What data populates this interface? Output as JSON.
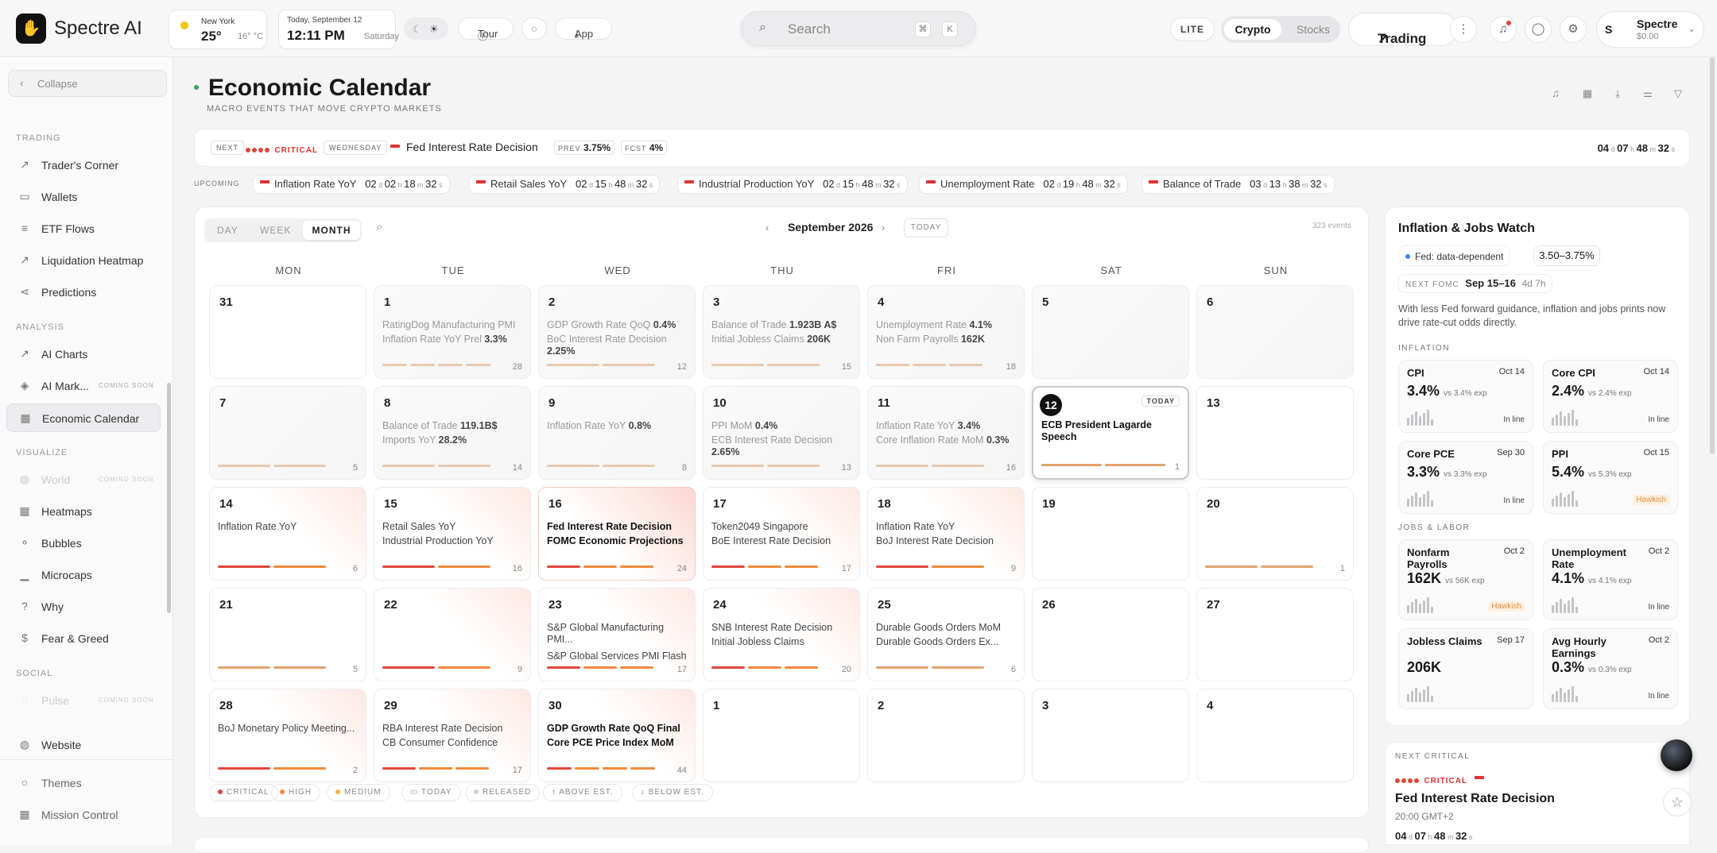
{
  "app": {
    "brand": "Spectre AI",
    "logo_icon": "hand-icon"
  },
  "weather": {
    "city": "New York",
    "temp": "25°",
    "range": "16° °C"
  },
  "datetime": {
    "date": "Today, September 12",
    "time": "12:11 PM",
    "weekday": "Saturday"
  },
  "topbar": {
    "tour": "Tour",
    "app": "App",
    "search_placeholder": "Search",
    "kbd1": "⌘",
    "kbd2": "K",
    "lite": "LITE",
    "crypto": "Crypto",
    "stocks": "Stocks",
    "trading": "Trading",
    "account_initial": "S",
    "account_name": "Spectre",
    "account_balance": "$0.00"
  },
  "sidebar": {
    "collapse": "Collapse",
    "sections": {
      "trading": "TRADING",
      "analysis": "ANALYSIS",
      "visualize": "VISUALIZE",
      "social": "SOCIAL"
    },
    "trading": [
      "Trader's Corner",
      "Wallets",
      "ETF Flows",
      "Liquidation Heatmap",
      "Predictions"
    ],
    "analysis": [
      "AI Charts",
      "AI Mark...",
      "Economic Calendar"
    ],
    "ai_markets_badge": "COMING SOON",
    "visualize": [
      "World",
      "Heatmaps",
      "Bubbles",
      "Microcaps",
      "Why",
      "Fear & Greed"
    ],
    "world_badge": "COMING SOON",
    "social": [
      "Pulse"
    ],
    "pulse_badge": "COMING SOON",
    "footer": [
      "Website",
      "Themes",
      "Mission Control"
    ]
  },
  "page": {
    "title": "Economic Calendar",
    "subtitle": "MACRO EVENTS THAT MOVE CRYPTO MARKETS"
  },
  "next_event": {
    "label": "NEXT",
    "impact": "CRITICAL",
    "day": "WEDNESDAY",
    "name": "Fed Interest Rate Decision",
    "prev_label": "PREV",
    "prev": "3.75%",
    "fcst_label": "FCST",
    "fcst": "4%",
    "countdown": {
      "d": "04",
      "h": "07",
      "m": "48",
      "s": "32"
    }
  },
  "upcoming": {
    "label": "UPCOMING",
    "items": [
      {
        "name": "Inflation Rate YoY",
        "d": "02",
        "h": "02",
        "m": "18",
        "s": "32"
      },
      {
        "name": "Retail Sales YoY",
        "d": "02",
        "h": "15",
        "m": "48",
        "s": "32"
      },
      {
        "name": "Industrial Production YoY",
        "d": "02",
        "h": "15",
        "m": "48",
        "s": "32"
      },
      {
        "name": "Unemployment Rate",
        "d": "02",
        "h": "19",
        "m": "48",
        "s": "32"
      },
      {
        "name": "Balance of Trade",
        "d": "03",
        "h": "13",
        "m": "38",
        "s": "32"
      }
    ]
  },
  "calendar": {
    "views": [
      "DAY",
      "WEEK",
      "MONTH"
    ],
    "month": "September 2026",
    "today_btn": "TODAY",
    "event_count": "323 events",
    "weekdays": [
      "MON",
      "TUE",
      "WED",
      "THU",
      "FRI",
      "SAT",
      "SUN"
    ],
    "today_badge": "TODAY",
    "cells": [
      {
        "day": "31",
        "events": [],
        "count": ""
      },
      {
        "day": "1",
        "events": [
          {
            "t": "RatingDog Manufacturing PMI",
            "v": ""
          },
          {
            "t": "Inflation Rate YoY Prel",
            "v": "3.3%"
          }
        ],
        "count": "28"
      },
      {
        "day": "2",
        "events": [
          {
            "t": "GDP Growth Rate QoQ",
            "v": "0.4%"
          },
          {
            "t": "BoC Interest Rate Decision",
            "v": "2.25%"
          }
        ],
        "count": "12"
      },
      {
        "day": "3",
        "events": [
          {
            "t": "Balance of Trade",
            "v": "1.923B A$"
          },
          {
            "t": "Initial Jobless Claims",
            "v": "206K"
          }
        ],
        "count": "15"
      },
      {
        "day": "4",
        "events": [
          {
            "t": "Unemployment Rate",
            "v": "4.1%"
          },
          {
            "t": "Non Farm Payrolls",
            "v": "162K"
          }
        ],
        "count": "18"
      },
      {
        "day": "5",
        "events": [],
        "count": ""
      },
      {
        "day": "6",
        "events": [],
        "count": ""
      },
      {
        "day": "7",
        "events": [],
        "count": "5"
      },
      {
        "day": "8",
        "events": [
          {
            "t": "Balance of Trade",
            "v": "119.1B$"
          },
          {
            "t": "Imports YoY",
            "v": "28.2%"
          }
        ],
        "count": "14"
      },
      {
        "day": "9",
        "events": [
          {
            "t": "Inflation Rate YoY",
            "v": "0.8%"
          }
        ],
        "count": "8"
      },
      {
        "day": "10",
        "events": [
          {
            "t": "PPI MoM",
            "v": "0.4%"
          },
          {
            "t": "ECB Interest Rate Decision",
            "v": "2.65%"
          }
        ],
        "count": "13"
      },
      {
        "day": "11",
        "events": [
          {
            "t": "Inflation Rate YoY",
            "v": "3.4%"
          },
          {
            "t": "Core Inflation Rate MoM",
            "v": "0.3%"
          }
        ],
        "count": "16"
      },
      {
        "day": "12",
        "events": [
          {
            "t": "ECB President Lagarde Speech",
            "v": ""
          }
        ],
        "count": "1"
      },
      {
        "day": "13",
        "events": [],
        "count": ""
      },
      {
        "day": "14",
        "events": [
          {
            "t": "Inflation Rate YoY",
            "v": ""
          }
        ],
        "count": "6"
      },
      {
        "day": "15",
        "events": [
          {
            "t": "Retail Sales YoY",
            "v": ""
          },
          {
            "t": "Industrial Production YoY",
            "v": ""
          }
        ],
        "count": "16"
      },
      {
        "day": "16",
        "events": [
          {
            "t": "Fed Interest Rate Decision",
            "v": ""
          },
          {
            "t": "FOMC Economic Projections",
            "v": ""
          }
        ],
        "count": "24"
      },
      {
        "day": "17",
        "events": [
          {
            "t": "Token2049 Singapore",
            "v": ""
          },
          {
            "t": "BoE Interest Rate Decision",
            "v": ""
          }
        ],
        "count": "17"
      },
      {
        "day": "18",
        "events": [
          {
            "t": "Inflation Rate YoY",
            "v": ""
          },
          {
            "t": "BoJ Interest Rate Decision",
            "v": ""
          }
        ],
        "count": "9"
      },
      {
        "day": "19",
        "events": [],
        "count": ""
      },
      {
        "day": "20",
        "events": [],
        "count": "1"
      },
      {
        "day": "21",
        "events": [],
        "count": "5"
      },
      {
        "day": "22",
        "events": [],
        "count": "9"
      },
      {
        "day": "23",
        "events": [
          {
            "t": "S&P Global Manufacturing PMI...",
            "v": ""
          },
          {
            "t": "S&P Global Services PMI Flash",
            "v": ""
          }
        ],
        "count": "17"
      },
      {
        "day": "24",
        "events": [
          {
            "t": "SNB Interest Rate Decision",
            "v": ""
          },
          {
            "t": "Initial Jobless Claims",
            "v": ""
          }
        ],
        "count": "20"
      },
      {
        "day": "25",
        "events": [
          {
            "t": "Durable Goods Orders MoM",
            "v": ""
          },
          {
            "t": "Durable Goods Orders Ex...",
            "v": ""
          }
        ],
        "count": "6"
      },
      {
        "day": "26",
        "events": [],
        "count": ""
      },
      {
        "day": "27",
        "events": [],
        "count": ""
      },
      {
        "day": "28",
        "events": [
          {
            "t": "BoJ Monetary Policy Meeting...",
            "v": ""
          }
        ],
        "count": "2"
      },
      {
        "day": "29",
        "events": [
          {
            "t": "RBA Interest Rate Decision",
            "v": ""
          },
          {
            "t": "CB Consumer Confidence",
            "v": ""
          }
        ],
        "count": "17"
      },
      {
        "day": "30",
        "events": [
          {
            "t": "GDP Growth Rate QoQ Final",
            "v": ""
          },
          {
            "t": "Core PCE Price Index MoM",
            "v": ""
          }
        ],
        "count": "44"
      },
      {
        "day": "1",
        "events": [],
        "count": ""
      },
      {
        "day": "2",
        "events": [],
        "count": ""
      },
      {
        "day": "3",
        "events": [],
        "count": ""
      },
      {
        "day": "4",
        "events": [],
        "count": ""
      }
    ],
    "legend": [
      "CRITICAL",
      "HIGH",
      "MEDIUM",
      "TODAY",
      "RELEASED",
      "ABOVE EST.",
      "BELOW EST."
    ]
  },
  "watch": {
    "title": "Inflation & Jobs Watch",
    "fed_stance": "Fed: data-dependent",
    "rate_range": "3.50–3.75%",
    "next_fomc_label": "NEXT FOMC",
    "next_fomc_date": "Sep 15–16",
    "next_fomc_in": "4d 7h",
    "description": "With less Fed forward guidance, inflation and jobs prints now drive rate-cut odds directly.",
    "inflation_label": "INFLATION",
    "jobs_label": "JOBS & LABOR",
    "inflation": [
      {
        "name": "CPI",
        "date": "Oct 14",
        "value": "3.4%",
        "exp": "vs 3.4% exp",
        "status": "In line"
      },
      {
        "name": "Core CPI",
        "date": "Oct 14",
        "value": "2.4%",
        "exp": "vs 2.4% exp",
        "status": "In line"
      },
      {
        "name": "Core PCE",
        "date": "Sep 30",
        "value": "3.3%",
        "exp": "vs 3.3% exp",
        "status": "In line"
      },
      {
        "name": "PPI",
        "date": "Oct 15",
        "value": "5.4%",
        "exp": "vs 5.3% exp",
        "status": "Hawkish"
      }
    ],
    "jobs": [
      {
        "name": "Nonfarm Payrolls",
        "date": "Oct 2",
        "value": "162K",
        "exp": "vs 56K exp",
        "status": "Hawkish"
      },
      {
        "name": "Unemployment Rate",
        "date": "Oct 2",
        "value": "4.1%",
        "exp": "vs 4.1% exp",
        "status": "In line"
      },
      {
        "name": "Jobless Claims",
        "date": "Sep 17",
        "value": "206K",
        "exp": "",
        "status": ""
      },
      {
        "name": "Avg Hourly Earnings",
        "date": "Oct 2",
        "value": "0.3%",
        "exp": "vs 0.3% exp",
        "status": "In line"
      }
    ]
  },
  "next_critical": {
    "label": "NEXT CRITICAL",
    "impact": "CRITICAL",
    "name": "Fed Interest Rate Decision",
    "time": "20:00 GMT+2",
    "countdown": {
      "d": "04",
      "h": "07",
      "m": "48",
      "s": "32"
    }
  },
  "colors": {
    "critical": "#e0463c",
    "high": "#f08a3c",
    "medium": "#f0b64a",
    "bar": "#e0a26e"
  }
}
